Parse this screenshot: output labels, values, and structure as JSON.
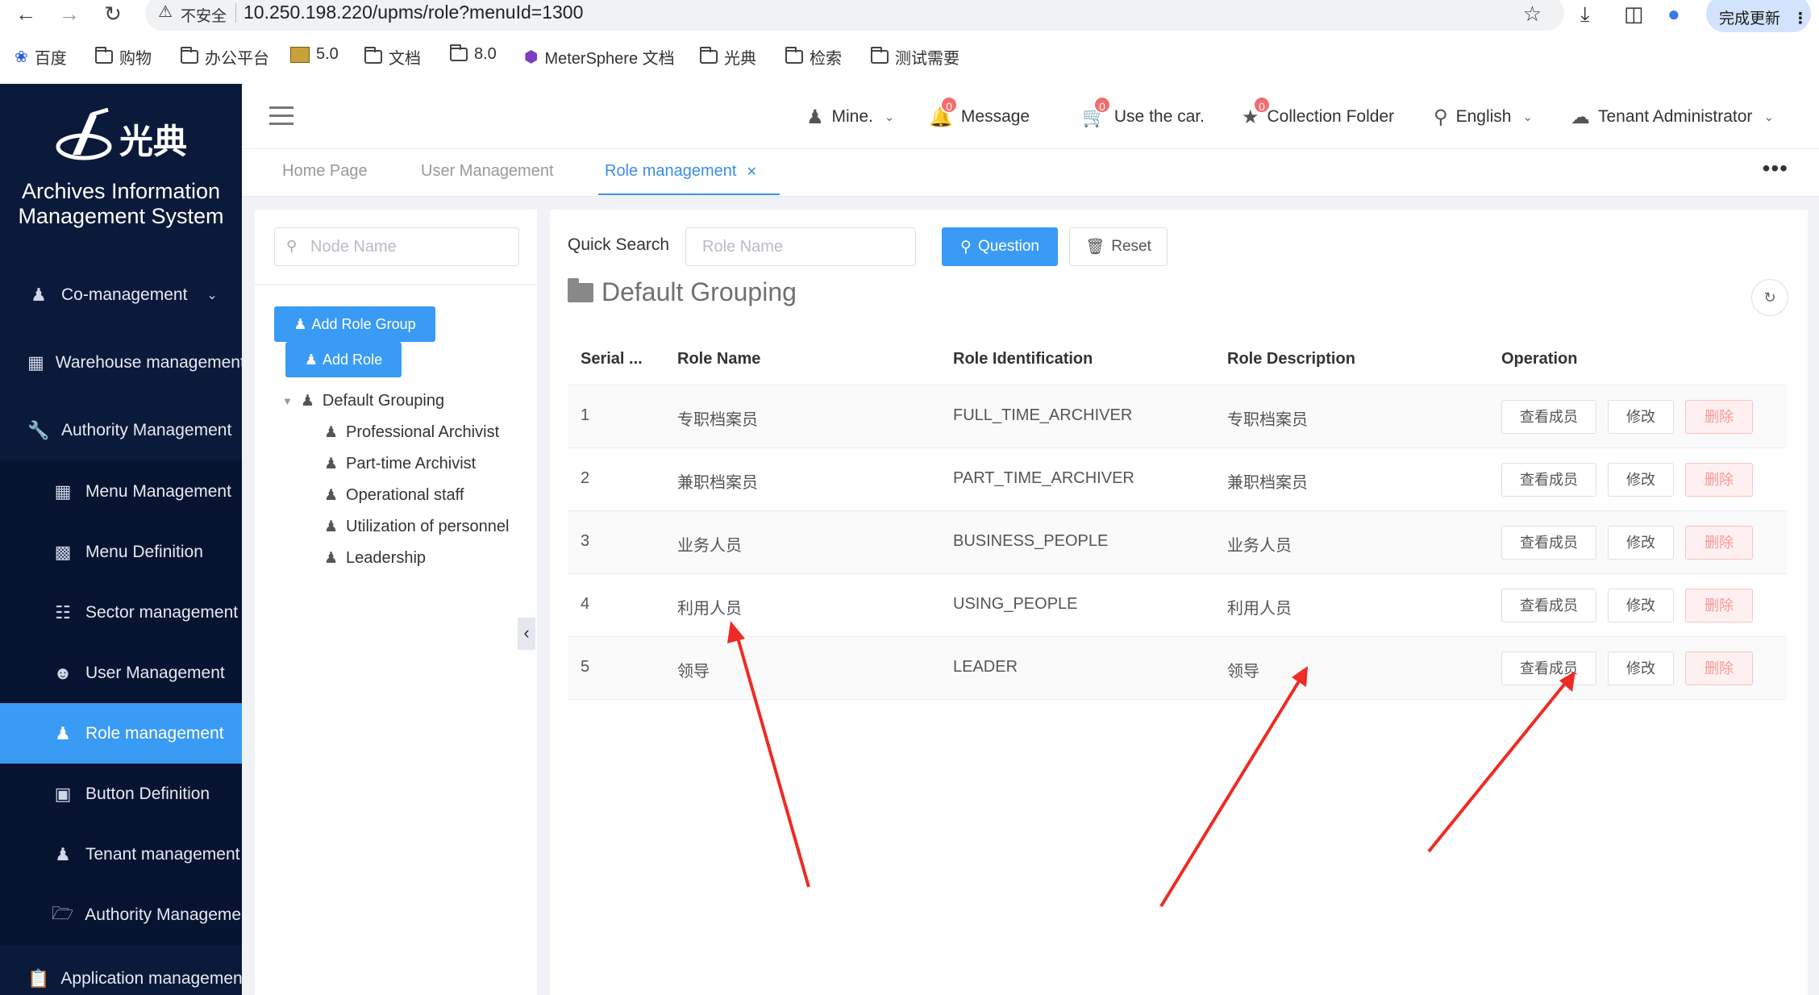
{
  "browser": {
    "insecure_label": "不安全",
    "url": "10.250.198.220/upms/role?menuId=1300",
    "update_label": "完成更新",
    "bookmarks": [
      "百度",
      "购物",
      "办公平台",
      "5.0",
      "文档",
      "8.0",
      "MeterSphere 文档",
      "光典",
      "检索",
      "测试需要"
    ]
  },
  "sidebar": {
    "logo_text": "光典",
    "system_title_line1": "Archives Information",
    "system_title_line2": "Management System",
    "items": [
      {
        "label": "Co-management",
        "icon": "user-group-icon"
      },
      {
        "label": "Warehouse management",
        "icon": "building-icon"
      },
      {
        "label": "Authority Management",
        "icon": "wrench-icon"
      },
      {
        "label": "Menu Management",
        "icon": "grid-icon"
      },
      {
        "label": "Menu Definition",
        "icon": "grid-small-icon"
      },
      {
        "label": "Sector management",
        "icon": "org-chart-icon"
      },
      {
        "label": "User Management",
        "icon": "user-icon"
      },
      {
        "label": "Role management",
        "icon": "user-solid-icon"
      },
      {
        "label": "Button Definition",
        "icon": "button-box-icon"
      },
      {
        "label": "Tenant management",
        "icon": "user-solid-icon"
      },
      {
        "label": "Authority Management",
        "icon": "folder-open-icon"
      },
      {
        "label": "Application management",
        "icon": "clipboard-icon"
      }
    ]
  },
  "header": {
    "mine_label": "Mine.",
    "message_label": "Message",
    "message_count": "0",
    "car_label": "Use the car.",
    "car_count": "0",
    "collection_label": "Collection Folder",
    "collection_count": "0",
    "language_label": "English",
    "tenant_label": "Tenant Administrator"
  },
  "tabs": [
    {
      "label": "Home Page"
    },
    {
      "label": "User Management"
    },
    {
      "label": "Role management"
    }
  ],
  "tree": {
    "search_placeholder": "Node Name",
    "add_group_label": "Add Role Group",
    "add_role_label": "Add Role",
    "root_label": "Default Grouping",
    "children": [
      "Professional Archivist",
      "Part-time Archivist",
      "Operational staff",
      "Utilization of personnel",
      "Leadership"
    ]
  },
  "main": {
    "quick_search_label": "Quick Search",
    "role_name_placeholder": "Role Name",
    "question_label": "Question",
    "reset_label": "Reset",
    "group_title": "Default Grouping",
    "columns": [
      "Serial ...",
      "Role Name",
      "Role Identification",
      "Role Description",
      "Operation"
    ],
    "rows": [
      {
        "serial": "1",
        "name": "专职档案员",
        "ident": "FULL_TIME_ARCHIVER",
        "desc": "专职档案员"
      },
      {
        "serial": "2",
        "name": "兼职档案员",
        "ident": "PART_TIME_ARCHIVER",
        "desc": "兼职档案员"
      },
      {
        "serial": "3",
        "name": "业务人员",
        "ident": "BUSINESS_PEOPLE",
        "desc": "业务人员"
      },
      {
        "serial": "4",
        "name": "利用人员",
        "ident": "USING_PEOPLE",
        "desc": "利用人员"
      },
      {
        "serial": "5",
        "name": "领导",
        "ident": "LEADER",
        "desc": "领导"
      }
    ],
    "op_view_label": "查看成员",
    "op_edit_label": "修改",
    "op_delete_label": "删除"
  },
  "colors": {
    "sidebar_bg": "#0b1a3a",
    "accent": "#3a9bf5",
    "annotation_arrow": "#ee2b24"
  }
}
